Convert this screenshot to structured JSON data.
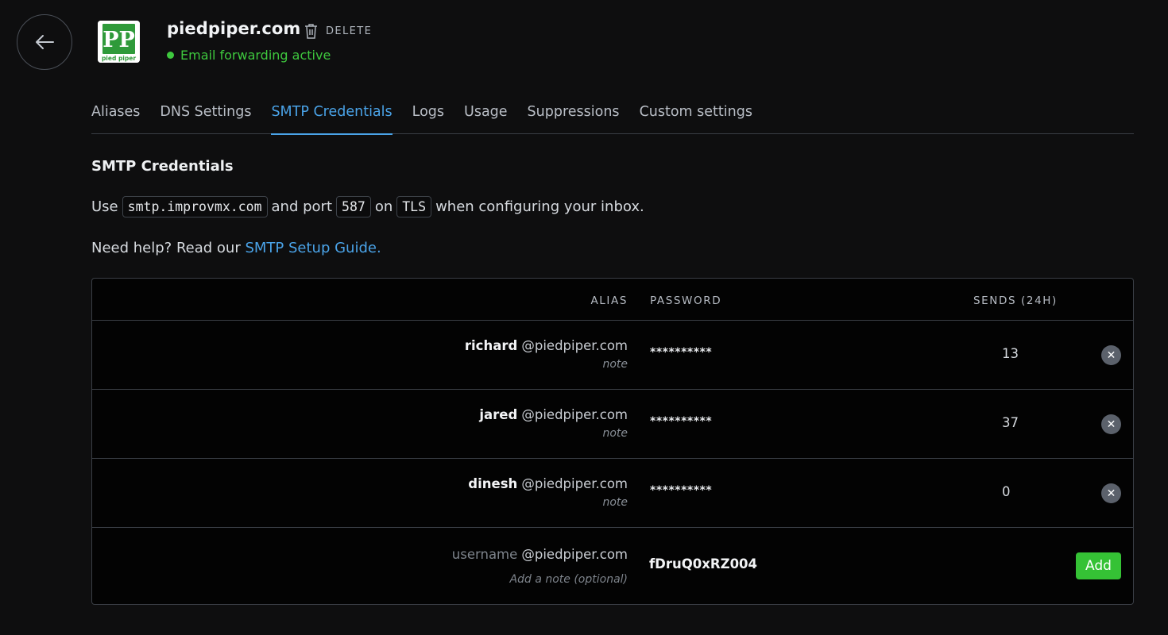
{
  "header": {
    "back_icon": "arrow-left-icon",
    "logo_text_small": "pied piper",
    "logo_letters": "PP",
    "domain": "piedpiper.com",
    "delete_label": "DELETE",
    "delete_icon": "trash-icon",
    "status_text": "Email forwarding active",
    "status_color": "#3ec83e"
  },
  "tabs": [
    {
      "label": "Aliases",
      "active": false
    },
    {
      "label": "DNS Settings",
      "active": false
    },
    {
      "label": "SMTP Credentials",
      "active": true
    },
    {
      "label": "Logs",
      "active": false
    },
    {
      "label": "Usage",
      "active": false
    },
    {
      "label": "Suppressions",
      "active": false
    },
    {
      "label": "Custom settings",
      "active": false
    }
  ],
  "smtp": {
    "title": "SMTP Credentials",
    "use_prefix": "Use",
    "host": "smtp.improvmx.com",
    "and_port": "and port",
    "port": "587",
    "on": "on",
    "protocol": "TLS",
    "suffix": "when configuring your inbox.",
    "help_prefix": "Need help? Read our",
    "help_link": "SMTP Setup Guide."
  },
  "table": {
    "headers": {
      "alias": "ALIAS",
      "password": "PASSWORD",
      "sends": "SENDS (24H)"
    },
    "rows": [
      {
        "name": "richard",
        "domain": "@piedpiper.com",
        "note": "note",
        "password": "**********",
        "sends": "13"
      },
      {
        "name": "jared",
        "domain": "@piedpiper.com",
        "note": "note",
        "password": "**********",
        "sends": "37"
      },
      {
        "name": "dinesh",
        "domain": "@piedpiper.com",
        "note": "note",
        "password": "**********",
        "sends": "0"
      }
    ],
    "remove_symbol": "✕",
    "new_row": {
      "username_placeholder": "username",
      "domain": "@piedpiper.com",
      "note_placeholder": "Add a note (optional)",
      "generated_password": "fDruQ0xRZ004",
      "add_label": "Add"
    }
  },
  "colors": {
    "accent": "#4aa3e8",
    "success": "#3ec83e",
    "add_button": "#35c235"
  }
}
